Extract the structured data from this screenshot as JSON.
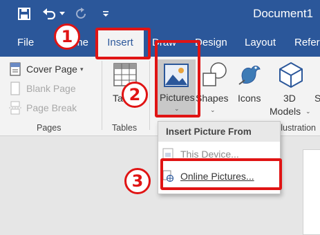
{
  "title_bar": {
    "document_title": "Document1",
    "icons": [
      "save-icon",
      "undo-icon",
      "undo-dropdown-icon",
      "redo-icon",
      "customize-quick-access-icon"
    ]
  },
  "tabs": [
    "File",
    "Home",
    "Insert",
    "Draw",
    "Design",
    "Layout",
    "Refere"
  ],
  "active_tab": "Insert",
  "ribbon": {
    "pages_group": {
      "cover_page": "Cover Page",
      "blank_page": "Blank Page",
      "page_break": "Page Break",
      "label": "Pages"
    },
    "tables_group": {
      "table": "Table",
      "label": "Tables"
    },
    "illustrations_group": {
      "pictures": "Pictures",
      "shapes": "Shapes",
      "icons": "Icons",
      "models_line1": "3D",
      "models_line2": "Models",
      "label_partial": "Illustration",
      "cut_off_button": "S"
    }
  },
  "dropdown": {
    "header": "Insert Picture From",
    "items": [
      "This Device...",
      "Online Pictures..."
    ]
  },
  "annotations": {
    "step1": "1",
    "step2": "2",
    "step3": "3"
  },
  "colors": {
    "accent": "#2b579a",
    "annotation_red": "#e01414",
    "ribbon_bg": "#f3f3f3"
  }
}
